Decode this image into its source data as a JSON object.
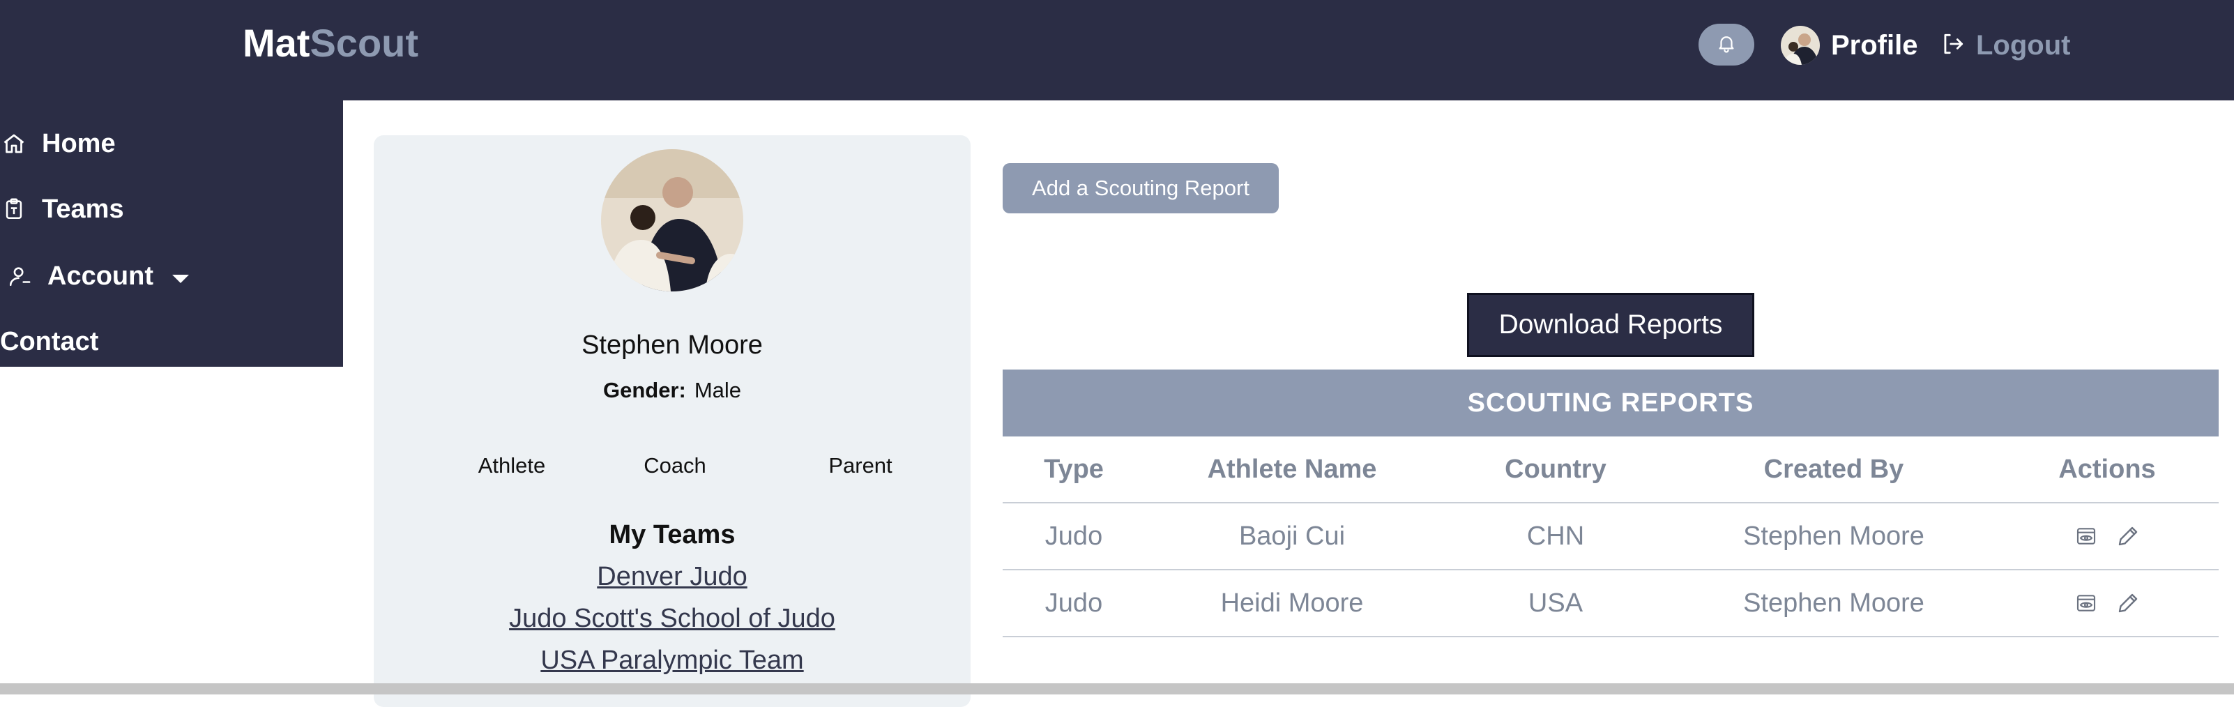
{
  "brand": {
    "part1": "Mat",
    "part2": "Scout"
  },
  "navbar": {
    "profile_label": "Profile",
    "logout_label": "Logout"
  },
  "sidebar": {
    "items": [
      {
        "label": "Home",
        "icon": "home-icon"
      },
      {
        "label": "Teams",
        "icon": "clipboard-icon"
      },
      {
        "label": "Account",
        "icon": "user-icon"
      },
      {
        "label": "Contact"
      }
    ]
  },
  "profile": {
    "name": "Stephen Moore",
    "gender_label": "Gender:",
    "gender_value": "Male",
    "roles": [
      "Athlete",
      "Coach",
      "Parent"
    ],
    "teams_title": "My Teams",
    "teams": [
      "Denver Judo",
      "Judo Scott's School of Judo",
      "USA Paralympic Team"
    ]
  },
  "actions": {
    "add_report_label": "Add a Scouting Report",
    "download_label": "Download Reports"
  },
  "reports_table": {
    "caption": "SCOUTING REPORTS",
    "columns": [
      "Type",
      "Athlete Name",
      "Country",
      "Created By",
      "Actions"
    ],
    "rows": [
      {
        "type": "Judo",
        "athlete": "Baoji Cui",
        "country": "CHN",
        "created_by": "Stephen Moore"
      },
      {
        "type": "Judo",
        "athlete": "Heidi Moore",
        "country": "USA",
        "created_by": "Stephen Moore"
      }
    ]
  },
  "colors": {
    "navy": "#2b2d45",
    "slate": "#8e9ab1",
    "card_bg": "#edf1f4"
  }
}
